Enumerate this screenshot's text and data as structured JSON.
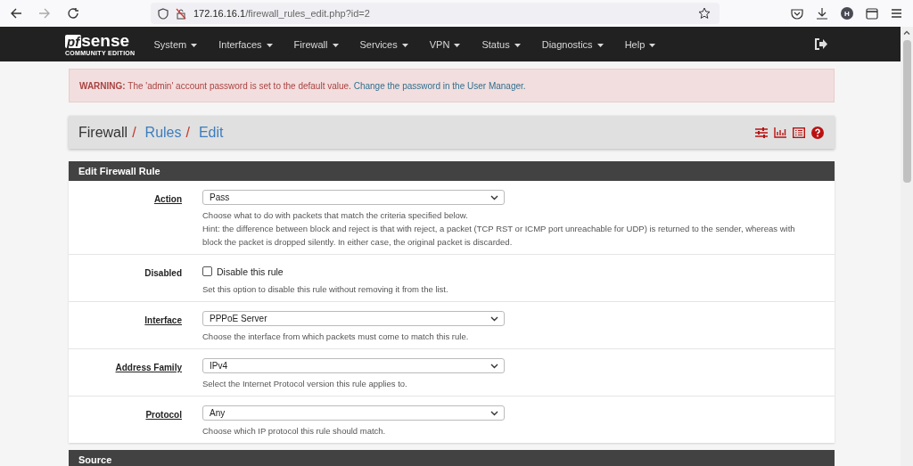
{
  "browser": {
    "url_host": "172.16.16.1",
    "url_path": "/firewall_rules_edit.php?id=2",
    "profile_initial": "H"
  },
  "navbar": {
    "logo_pf": "pf",
    "logo_sense": "sense",
    "logo_sub": "COMMUNITY EDITION",
    "menus": [
      "System",
      "Interfaces",
      "Firewall",
      "Services",
      "VPN",
      "Status",
      "Diagnostics",
      "Help"
    ]
  },
  "warning": {
    "label": "WARNING:",
    "text": "The 'admin' account password is set to the default value.",
    "link": "Change the password in the User Manager."
  },
  "breadcrumb": [
    {
      "text": "Firewall",
      "link": false
    },
    {
      "text": "Rules",
      "link": true
    },
    {
      "text": "Edit",
      "link": true
    }
  ],
  "breadcrumb_separator": "/",
  "panel": {
    "title": "Edit Firewall Rule",
    "fields": [
      {
        "kind": "select",
        "label": "Action",
        "value": "Pass",
        "help": [
          "Choose what to do with packets that match the criteria specified below.",
          "Hint: the difference between block and reject is that with reject, a packet (TCP RST or ICMP port unreachable for UDP) is returned to the sender, whereas with block the packet is dropped silently. In either case, the original packet is discarded."
        ]
      },
      {
        "kind": "checkbox",
        "label": "Disabled",
        "value": "Disable this rule",
        "checked": false,
        "help": [
          "Set this option to disable this rule without removing it from the list."
        ]
      },
      {
        "kind": "select",
        "label": "Interface",
        "value": "PPPoE Server",
        "help": [
          "Choose the interface from which packets must come to match this rule."
        ]
      },
      {
        "kind": "select",
        "label": "Address Family",
        "value": "IPv4",
        "help": [
          "Select the Internet Protocol version this rule applies to."
        ]
      },
      {
        "kind": "select",
        "label": "Protocol",
        "value": "Any",
        "help": [
          "Choose which IP protocol this rule should match."
        ]
      }
    ]
  },
  "next_panel": {
    "title": "Source"
  }
}
